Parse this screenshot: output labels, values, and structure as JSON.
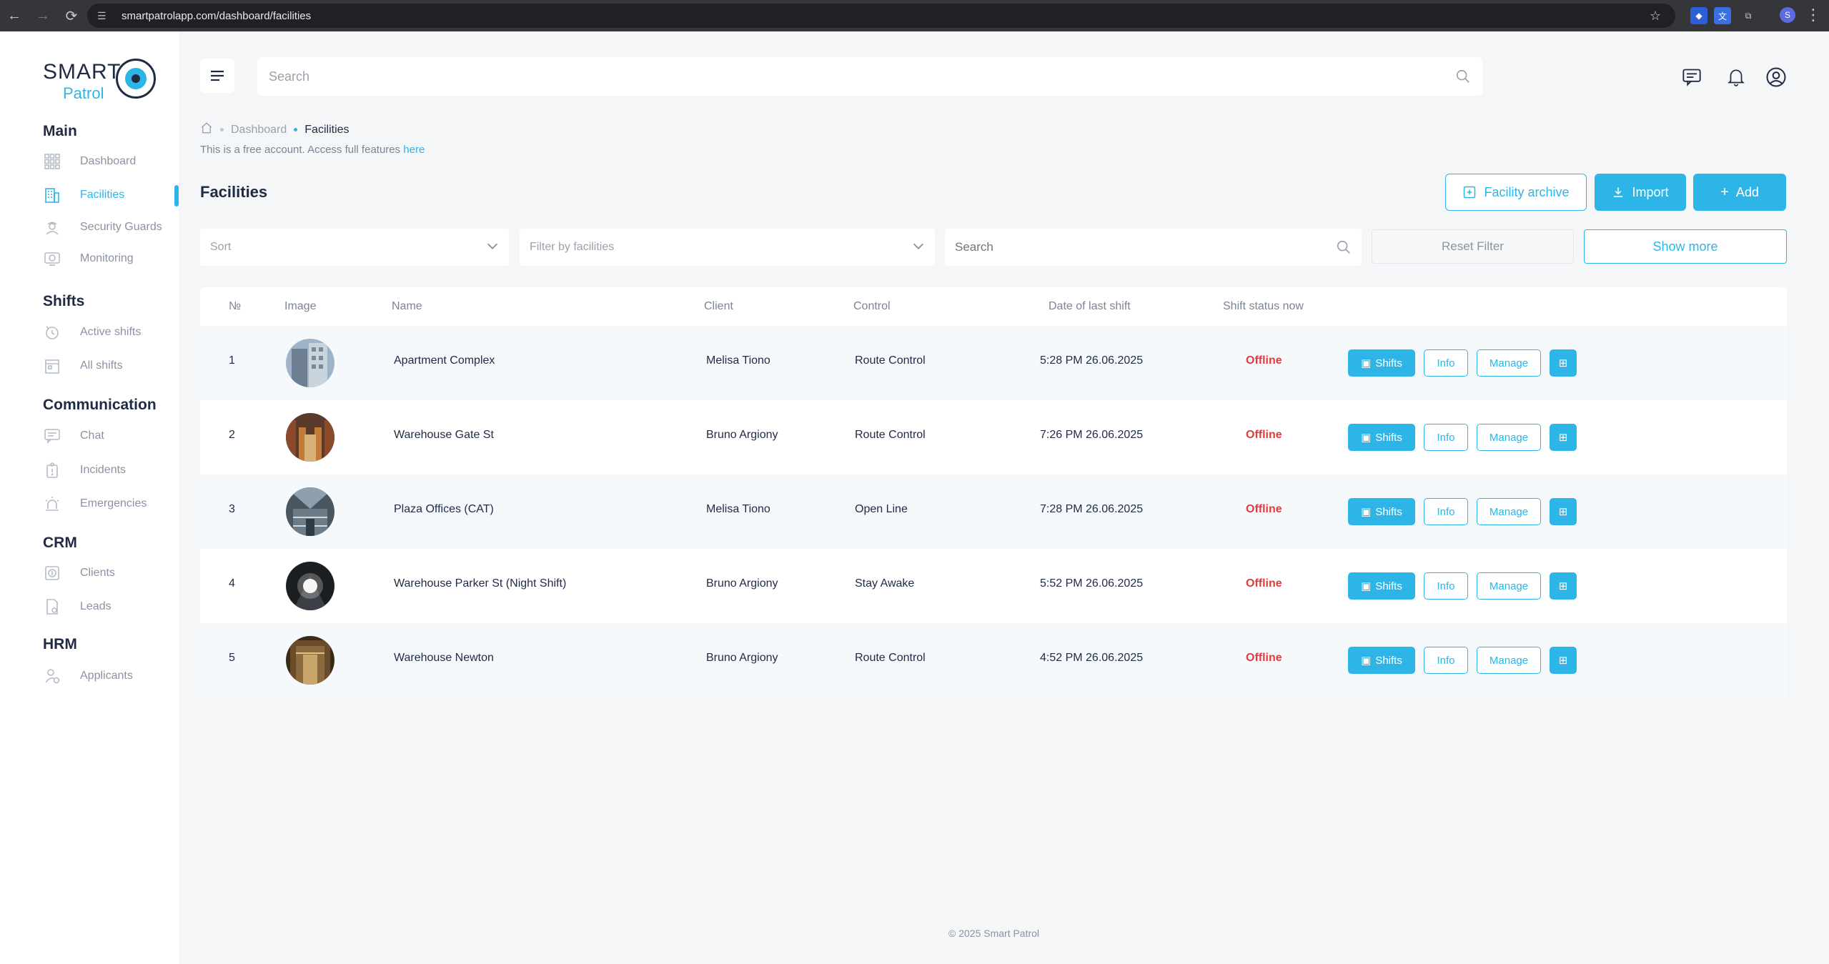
{
  "browser": {
    "url": "smartpatrolapp.com/dashboard/facilities",
    "profile_initial": "S"
  },
  "logo": {
    "line1": "SMART",
    "line2": "Patrol"
  },
  "sidebar": {
    "sections": [
      {
        "title": "Main",
        "items": [
          {
            "label": "Dashboard",
            "icon": "grid-icon"
          },
          {
            "label": "Facilities",
            "icon": "building-icon",
            "active": true
          },
          {
            "label": "Security Guards",
            "icon": "guard-icon"
          },
          {
            "label": "Monitoring",
            "icon": "camera-icon"
          }
        ]
      },
      {
        "title": "Shifts",
        "items": [
          {
            "label": "Active shifts",
            "icon": "clock-icon"
          },
          {
            "label": "All shifts",
            "icon": "calendar-icon"
          }
        ]
      },
      {
        "title": "Communication",
        "items": [
          {
            "label": "Chat",
            "icon": "chat-icon"
          },
          {
            "label": "Incidents",
            "icon": "incident-icon"
          },
          {
            "label": "Emergencies",
            "icon": "siren-icon"
          }
        ]
      },
      {
        "title": "CRM",
        "items": [
          {
            "label": "Clients",
            "icon": "clients-icon"
          },
          {
            "label": "Leads",
            "icon": "leads-icon"
          }
        ]
      },
      {
        "title": "HRM",
        "items": [
          {
            "label": "Applicants",
            "icon": "applicant-icon"
          }
        ]
      }
    ]
  },
  "header": {
    "search_placeholder": "Search"
  },
  "breadcrumb": {
    "parent": "Dashboard",
    "current": "Facilities"
  },
  "notice": {
    "text": "This is a free account. Access full features ",
    "link": "here"
  },
  "page": {
    "title": "Facilities",
    "archive_label": "Facility archive",
    "import_label": "Import",
    "add_label": "Add"
  },
  "filters": {
    "sort_placeholder": "Sort",
    "facility_placeholder": "Filter by facilities",
    "search_placeholder": "Search",
    "reset_label": "Reset Filter",
    "more_label": "Show more"
  },
  "table": {
    "columns": [
      "№",
      "Image",
      "Name",
      "Client",
      "Control",
      "Date of last shift",
      "Shift status now"
    ],
    "rows": [
      {
        "num": "1",
        "name": "Apartment Complex",
        "client": "Melisa Tiono",
        "control": "Route Control",
        "date": "5:28 PM 26.06.2025",
        "status": "Offline"
      },
      {
        "num": "2",
        "name": "Warehouse Gate St",
        "client": "Bruno Argiony",
        "control": "Route Control",
        "date": "7:26 PM 26.06.2025",
        "status": "Offline"
      },
      {
        "num": "3",
        "name": "Plaza Offices (CAT)",
        "client": "Melisa Tiono",
        "control": "Open Line",
        "date": "7:28 PM 26.06.2025",
        "status": "Offline"
      },
      {
        "num": "4",
        "name": "Warehouse Parker St (Night Shift)",
        "client": "Bruno Argiony",
        "control": "Stay Awake",
        "date": "5:52 PM 26.06.2025",
        "status": "Offline"
      },
      {
        "num": "5",
        "name": "Warehouse Newton",
        "client": "Bruno Argiony",
        "control": "Route Control",
        "date": "4:52 PM 26.06.2025",
        "status": "Offline"
      }
    ],
    "actions": {
      "shifts": "Shifts",
      "info": "Info",
      "manage": "Manage"
    }
  },
  "footer": {
    "text": "© 2025 Smart Patrol"
  },
  "colors": {
    "accent": "#2eb5e8",
    "offline": "#e03c3c",
    "navy": "#1f2a44"
  }
}
